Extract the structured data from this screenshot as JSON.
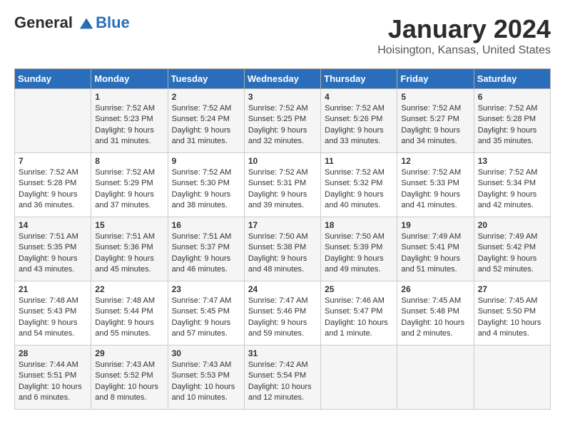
{
  "header": {
    "logo_line1": "General",
    "logo_line2": "Blue",
    "month": "January 2024",
    "location": "Hoisington, Kansas, United States"
  },
  "days_of_week": [
    "Sunday",
    "Monday",
    "Tuesday",
    "Wednesday",
    "Thursday",
    "Friday",
    "Saturday"
  ],
  "weeks": [
    [
      {
        "day": "",
        "content": ""
      },
      {
        "day": "1",
        "content": "Sunrise: 7:52 AM\nSunset: 5:23 PM\nDaylight: 9 hours\nand 31 minutes."
      },
      {
        "day": "2",
        "content": "Sunrise: 7:52 AM\nSunset: 5:24 PM\nDaylight: 9 hours\nand 31 minutes."
      },
      {
        "day": "3",
        "content": "Sunrise: 7:52 AM\nSunset: 5:25 PM\nDaylight: 9 hours\nand 32 minutes."
      },
      {
        "day": "4",
        "content": "Sunrise: 7:52 AM\nSunset: 5:26 PM\nDaylight: 9 hours\nand 33 minutes."
      },
      {
        "day": "5",
        "content": "Sunrise: 7:52 AM\nSunset: 5:27 PM\nDaylight: 9 hours\nand 34 minutes."
      },
      {
        "day": "6",
        "content": "Sunrise: 7:52 AM\nSunset: 5:28 PM\nDaylight: 9 hours\nand 35 minutes."
      }
    ],
    [
      {
        "day": "7",
        "content": "Sunrise: 7:52 AM\nSunset: 5:28 PM\nDaylight: 9 hours\nand 36 minutes."
      },
      {
        "day": "8",
        "content": "Sunrise: 7:52 AM\nSunset: 5:29 PM\nDaylight: 9 hours\nand 37 minutes."
      },
      {
        "day": "9",
        "content": "Sunrise: 7:52 AM\nSunset: 5:30 PM\nDaylight: 9 hours\nand 38 minutes."
      },
      {
        "day": "10",
        "content": "Sunrise: 7:52 AM\nSunset: 5:31 PM\nDaylight: 9 hours\nand 39 minutes."
      },
      {
        "day": "11",
        "content": "Sunrise: 7:52 AM\nSunset: 5:32 PM\nDaylight: 9 hours\nand 40 minutes."
      },
      {
        "day": "12",
        "content": "Sunrise: 7:52 AM\nSunset: 5:33 PM\nDaylight: 9 hours\nand 41 minutes."
      },
      {
        "day": "13",
        "content": "Sunrise: 7:52 AM\nSunset: 5:34 PM\nDaylight: 9 hours\nand 42 minutes."
      }
    ],
    [
      {
        "day": "14",
        "content": "Sunrise: 7:51 AM\nSunset: 5:35 PM\nDaylight: 9 hours\nand 43 minutes."
      },
      {
        "day": "15",
        "content": "Sunrise: 7:51 AM\nSunset: 5:36 PM\nDaylight: 9 hours\nand 45 minutes."
      },
      {
        "day": "16",
        "content": "Sunrise: 7:51 AM\nSunset: 5:37 PM\nDaylight: 9 hours\nand 46 minutes."
      },
      {
        "day": "17",
        "content": "Sunrise: 7:50 AM\nSunset: 5:38 PM\nDaylight: 9 hours\nand 48 minutes."
      },
      {
        "day": "18",
        "content": "Sunrise: 7:50 AM\nSunset: 5:39 PM\nDaylight: 9 hours\nand 49 minutes."
      },
      {
        "day": "19",
        "content": "Sunrise: 7:49 AM\nSunset: 5:41 PM\nDaylight: 9 hours\nand 51 minutes."
      },
      {
        "day": "20",
        "content": "Sunrise: 7:49 AM\nSunset: 5:42 PM\nDaylight: 9 hours\nand 52 minutes."
      }
    ],
    [
      {
        "day": "21",
        "content": "Sunrise: 7:48 AM\nSunset: 5:43 PM\nDaylight: 9 hours\nand 54 minutes."
      },
      {
        "day": "22",
        "content": "Sunrise: 7:48 AM\nSunset: 5:44 PM\nDaylight: 9 hours\nand 55 minutes."
      },
      {
        "day": "23",
        "content": "Sunrise: 7:47 AM\nSunset: 5:45 PM\nDaylight: 9 hours\nand 57 minutes."
      },
      {
        "day": "24",
        "content": "Sunrise: 7:47 AM\nSunset: 5:46 PM\nDaylight: 9 hours\nand 59 minutes."
      },
      {
        "day": "25",
        "content": "Sunrise: 7:46 AM\nSunset: 5:47 PM\nDaylight: 10 hours\nand 1 minute."
      },
      {
        "day": "26",
        "content": "Sunrise: 7:45 AM\nSunset: 5:48 PM\nDaylight: 10 hours\nand 2 minutes."
      },
      {
        "day": "27",
        "content": "Sunrise: 7:45 AM\nSunset: 5:50 PM\nDaylight: 10 hours\nand 4 minutes."
      }
    ],
    [
      {
        "day": "28",
        "content": "Sunrise: 7:44 AM\nSunset: 5:51 PM\nDaylight: 10 hours\nand 6 minutes."
      },
      {
        "day": "29",
        "content": "Sunrise: 7:43 AM\nSunset: 5:52 PM\nDaylight: 10 hours\nand 8 minutes."
      },
      {
        "day": "30",
        "content": "Sunrise: 7:43 AM\nSunset: 5:53 PM\nDaylight: 10 hours\nand 10 minutes."
      },
      {
        "day": "31",
        "content": "Sunrise: 7:42 AM\nSunset: 5:54 PM\nDaylight: 10 hours\nand 12 minutes."
      },
      {
        "day": "",
        "content": ""
      },
      {
        "day": "",
        "content": ""
      },
      {
        "day": "",
        "content": ""
      }
    ]
  ]
}
